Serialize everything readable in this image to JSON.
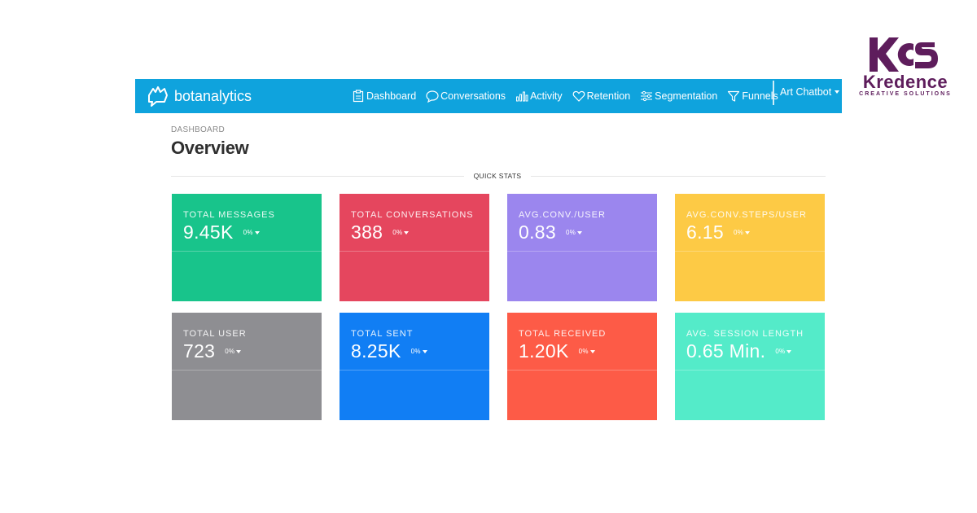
{
  "branding": {
    "kcs_mark": "KCS",
    "kcs_name": "Kredence",
    "kcs_tagline": "CREATIVE SOLUTIONS",
    "color": "#5e1d5c"
  },
  "app": {
    "brand": "botanalytics",
    "nav": [
      {
        "label": "Dashboard",
        "icon": "clipboard-icon"
      },
      {
        "label": "Conversations",
        "icon": "chat-bubble-icon"
      },
      {
        "label": "Activity",
        "icon": "bar-chart-icon"
      },
      {
        "label": "Retention",
        "icon": "heart-icon"
      },
      {
        "label": "Segmentation",
        "icon": "sliders-icon"
      },
      {
        "label": "Funnels",
        "icon": "funnel-icon"
      }
    ],
    "bot_selector": "Art Chatbot",
    "accent": "#0fa3dd"
  },
  "page": {
    "breadcrumb": "DASHBOARD",
    "title": "Overview",
    "section_label": "QUICK STATS"
  },
  "stats": [
    {
      "label": "TOTAL MESSAGES",
      "value": "9.45K",
      "delta": "0%",
      "color": "#18c48b"
    },
    {
      "label": "TOTAL CONVERSATIONS",
      "value": "388",
      "delta": "0%",
      "color": "#e5465e"
    },
    {
      "label": "AVG.CONV./USER",
      "value": "0.83",
      "delta": "0%",
      "color": "#9b86ee"
    },
    {
      "label": "AVG.CONV.STEPS/USER",
      "value": "6.15",
      "delta": "0%",
      "color": "#fdca45"
    },
    {
      "label": "TOTAL USER",
      "value": "723",
      "delta": "0%",
      "color": "#8e8e92"
    },
    {
      "label": "TOTAL SENT",
      "value": "8.25K",
      "delta": "0%",
      "color": "#117ef4"
    },
    {
      "label": "TOTAL RECEIVED",
      "value": "1.20K",
      "delta": "0%",
      "color": "#fd5b47"
    },
    {
      "label": "AVG. SESSION LENGTH",
      "value": "0.65 Min.",
      "delta": "0%",
      "color": "#54ebc9"
    }
  ]
}
